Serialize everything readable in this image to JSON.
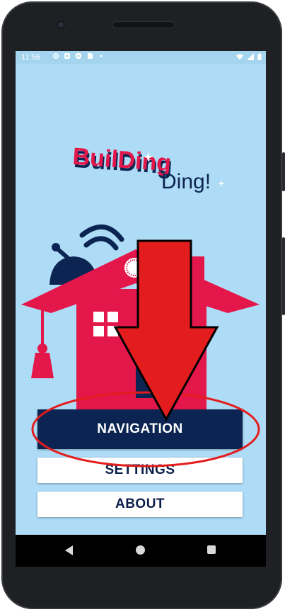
{
  "status_bar": {
    "time": "11:56",
    "icons": [
      "gear-icon",
      "notification-icon",
      "shield-icon",
      "sim-icon",
      "dot-icon"
    ],
    "right_icons": [
      "wifi-icon",
      "signal-icon",
      "battery-icon"
    ]
  },
  "logo": {
    "text_line1": "BuilDing",
    "text_line2": "Ding!",
    "colors": {
      "red": "#e4174b",
      "navy": "#0c2451"
    }
  },
  "buttons": {
    "navigation": "NAVIGATION",
    "settings": "SETTINGS",
    "about": "ABOUT"
  },
  "colors": {
    "screen_bg": "#aedcf6",
    "primary_navy": "#0c2451",
    "accent_red": "#e4174b",
    "annotation_red": "#e31d1d"
  },
  "navigation_bar": {
    "icons": [
      "back-icon",
      "home-icon",
      "recents-icon"
    ]
  }
}
